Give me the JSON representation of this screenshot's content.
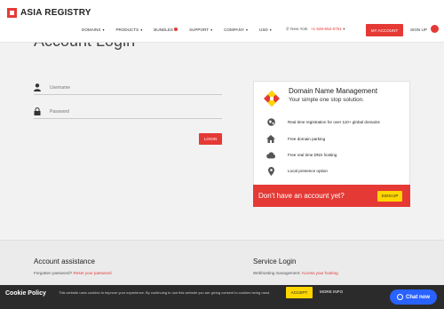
{
  "header": {
    "brand": "ASIA REGISTRY",
    "nav": [
      {
        "label": "DOMAINS",
        "caret": true
      },
      {
        "label": "PRODUCTS",
        "caret": true
      },
      {
        "label": "BUNDLES",
        "caret": false,
        "dot": true
      },
      {
        "label": "SUPPORT",
        "caret": true
      },
      {
        "label": "COMPANY",
        "caret": true
      },
      {
        "label": "USD",
        "caret": true
      }
    ],
    "location": "New York",
    "phone": "+1 646-652-0751",
    "my_account": "MY ACCOUNT",
    "signup": "SIGN UP",
    "accent": "#e53935"
  },
  "main": {
    "title": "Account Login",
    "username_placeholder": "Username",
    "password_placeholder": "Password",
    "login_label": "LOGIN"
  },
  "panel": {
    "title": "Domain Name Management",
    "subtitle": "Your simple one stop solution.",
    "features": [
      {
        "icon": "globe-icon",
        "text": "Real time registration for over 110+ global domains"
      },
      {
        "icon": "home-icon",
        "text": "Free domain parking"
      },
      {
        "icon": "cloud-icon",
        "text": "Free real time DNS hosting"
      },
      {
        "icon": "location-pin-icon",
        "text": "Local presence option"
      }
    ],
    "cta_question": "Don't have an account yet?",
    "cta_button": "SIGN UP"
  },
  "footer": {
    "assist_title": "Account assistance",
    "assist_text": "Forgotten password?",
    "assist_link": "Reset your password",
    "service_title": "Service Login",
    "service_text": "Webhosting management:",
    "service_link": "Access your hosting"
  },
  "cookie": {
    "title": "Cookie Policy",
    "text": "This website uses cookies to improve your experience. By continuing to use this website you are giving consent to cookies being used.",
    "accept": "ACCEPT",
    "more_info": "MORE INFO",
    "chat": "Chat now"
  }
}
